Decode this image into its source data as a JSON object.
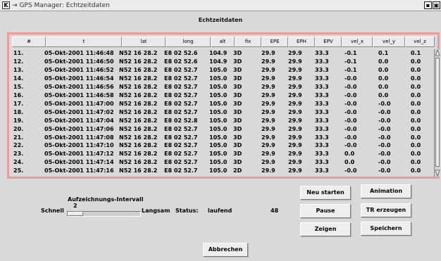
{
  "window": {
    "title": "GPS Manager: Echtzeitdaten",
    "pin_glyph": "⇥",
    "logo_glyph": "K",
    "controls": [
      "▪",
      "▣"
    ]
  },
  "heading": "Echtzeitdaten",
  "table": {
    "columns": [
      "#",
      "t",
      "lat",
      "long",
      "alt",
      "fix",
      "EPE",
      "EPH",
      "EPV",
      "vel_x",
      "vel_y",
      "vel_z"
    ],
    "rows": [
      [
        "11.",
        "05-Okt-2001 11:46:48",
        "N52 16 28.2",
        "E8 02 52.6",
        "104.9",
        "3D",
        "29.9",
        "29.9",
        "33.3",
        "-0.1",
        "0.1",
        "0.1"
      ],
      [
        "12.",
        "05-Okt-2001 11:46:50",
        "N52 16 28.2",
        "E8 02 52.6",
        "104.9",
        "3D",
        "29.9",
        "29.9",
        "33.3",
        "-0.1",
        "0.0",
        "0.0"
      ],
      [
        "13.",
        "05-Okt-2001 11:46:52",
        "N52 16 28.2",
        "E8 02 52.7",
        "105.0",
        "3D",
        "29.9",
        "29.9",
        "33.3",
        "-0.1",
        "0.0",
        "0.0"
      ],
      [
        "14.",
        "05-Okt-2001 11:46:54",
        "N52 16 28.2",
        "E8 02 52.7",
        "105.0",
        "3D",
        "29.9",
        "29.9",
        "33.3",
        "-0.0",
        "0.0",
        "0.0"
      ],
      [
        "15.",
        "05-Okt-2001 11:46:56",
        "N52 16 28.2",
        "E8 02 52.7",
        "105.0",
        "3D",
        "29.9",
        "29.9",
        "33.3",
        "-0.0",
        "0.0",
        "0.0"
      ],
      [
        "16.",
        "05-Okt-2001 11:46:58",
        "N52 16 28.2",
        "E8 02 52.7",
        "105.0",
        "3D",
        "29.9",
        "29.9",
        "33.3",
        "-0.0",
        "0.0",
        "0.0"
      ],
      [
        "17.",
        "05-Okt-2001 11:47:00",
        "N52 16 28.2",
        "E8 02 52.7",
        "105.0",
        "3D",
        "29.9",
        "29.9",
        "33.3",
        "-0.0",
        "-0.0",
        "0.0"
      ],
      [
        "18.",
        "05-Okt-2001 11:47:02",
        "N52 16 28.2",
        "E8 02 52.7",
        "105.0",
        "3D",
        "29.9",
        "29.9",
        "33.3",
        "-0.0",
        "-0.0",
        "0.0"
      ],
      [
        "19.",
        "05-Okt-2001 11:47:04",
        "N52 16 28.2",
        "E8 02 52.8",
        "105.0",
        "3D",
        "29.9",
        "29.9",
        "33.3",
        "-0.0",
        "-0.0",
        "0.0"
      ],
      [
        "20.",
        "05-Okt-2001 11:47:06",
        "N52 16 28.2",
        "E8 02 52.7",
        "105.0",
        "3D",
        "29.9",
        "29.9",
        "33.3",
        "-0.0",
        "-0.0",
        "0.0"
      ],
      [
        "21.",
        "05-Okt-2001 11:47:08",
        "N52 16 28.2",
        "E8 02 52.7",
        "105.0",
        "3D",
        "29.9",
        "29.9",
        "33.3",
        "-0.0",
        "-0.0",
        "0.0"
      ],
      [
        "22.",
        "05-Okt-2001 11:47:10",
        "N52 16 28.2",
        "E8 02 52.7",
        "105.0",
        "3D",
        "29.9",
        "29.9",
        "33.3",
        "-0.0",
        "-0.0",
        "0.0"
      ],
      [
        "23.",
        "05-Okt-2001 11:47:12",
        "N52 16 28.2",
        "E8 02 52.7",
        "105.0",
        "3D",
        "29.9",
        "29.9",
        "33.3",
        "0.0",
        "-0.0",
        "0.0"
      ],
      [
        "24.",
        "05-Okt-2001 11:47:14",
        "N52 16 28.2",
        "E8 02 52.7",
        "105.0",
        "3D",
        "29.9",
        "29.9",
        "33.3",
        "0.0",
        "-0.0",
        "0.0"
      ],
      [
        "25.",
        "05-Okt-2001 11:47:16",
        "N52 16 28.2",
        "E8 02 52.7",
        "105.0",
        "2D",
        "29.9",
        "29.9",
        "33.3",
        "-0.0",
        "-0.0",
        "0.0"
      ]
    ]
  },
  "controls": {
    "schnell_label": "Schnell",
    "langsam_label": "Langsam",
    "interval_title": "Aufzeichnungs-Intervall",
    "interval_value": "2",
    "status_label": "Status:",
    "status_value": "laufend",
    "count": "48"
  },
  "buttons": {
    "neu_starten": "Neu starten",
    "animation": "Animation",
    "pause": "Pause",
    "tr_erzeugen": "TR erzeugen",
    "zeigen": "Zeigen",
    "speichern": "Speichern",
    "abbrechen": "Abbrechen"
  },
  "colors": {
    "table_border": "#ef9a9a",
    "background": "#d9d9d9"
  }
}
